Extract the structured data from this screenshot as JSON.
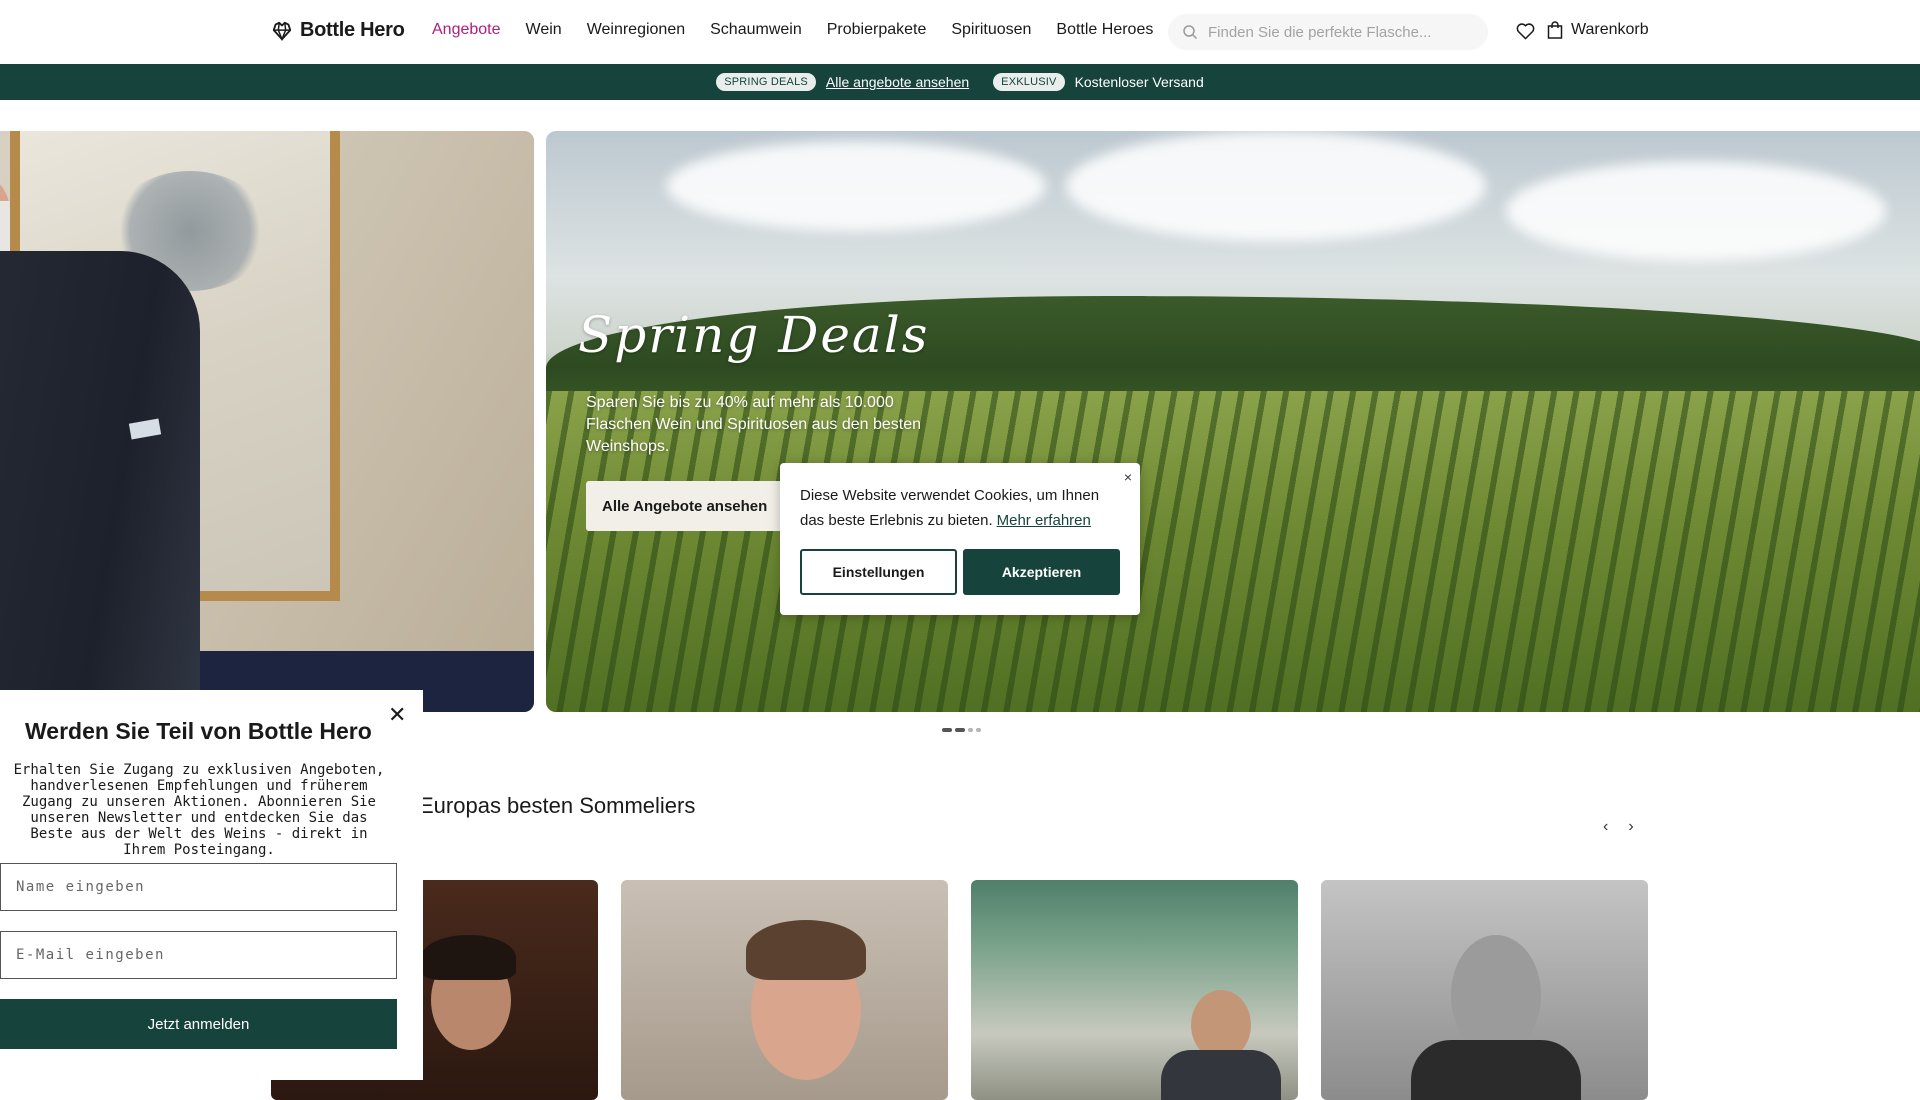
{
  "header": {
    "logo_text": "Bottle Hero",
    "nav": [
      {
        "label": "Angebote",
        "active": true
      },
      {
        "label": "Wein"
      },
      {
        "label": "Weinregionen"
      },
      {
        "label": "Schaumwein"
      },
      {
        "label": "Probierpakete"
      },
      {
        "label": "Spirituosen"
      },
      {
        "label": "Bottle Heroes"
      }
    ],
    "search_placeholder": "Finden Sie die perfekte Flasche...",
    "cart_label": "Warenkorb"
  },
  "promo": {
    "pill1": "SPRING DEALS",
    "link": "Alle angebote ansehen",
    "pill2": "EXKLUSIV",
    "text": "Kostenloser Versand"
  },
  "hero": {
    "title": "Spring Deals",
    "subtitle": "Sparen Sie bis zu 40% auf mehr als 10.000 Flaschen Wein und Spirituosen aus den besten Weinshops.",
    "button": "Alle Angebote ansehen",
    "slides_count": 4,
    "active_slide": 2
  },
  "cookie": {
    "text": "Diese Website verwendet Cookies, um Ihnen das beste Erlebnis zu bieten.",
    "more_link": "Mehr erfahren",
    "close": "×",
    "settings_button": "Einstellungen",
    "accept_button": "Akzeptieren"
  },
  "section": {
    "title": "Europas besten Sommeliers",
    "prev": "‹",
    "next": "›"
  },
  "newsletter": {
    "title": "Werden Sie Teil von Bottle Hero",
    "text": "Erhalten Sie Zugang zu exklusiven Angeboten, handverlesenen Empfehlungen und früherem Zugang zu unseren Aktionen. Abonnieren Sie unseren Newsletter und entdecken Sie das Beste aus der Welt des Weins - direkt in Ihrem Posteingang.",
    "name_placeholder": "Name eingeben",
    "email_placeholder": "E-Mail eingeben",
    "button": "Jetzt anmelden",
    "close": "✕"
  },
  "colors": {
    "brand_green": "#16433b",
    "accent_magenta": "#b21c7a"
  }
}
